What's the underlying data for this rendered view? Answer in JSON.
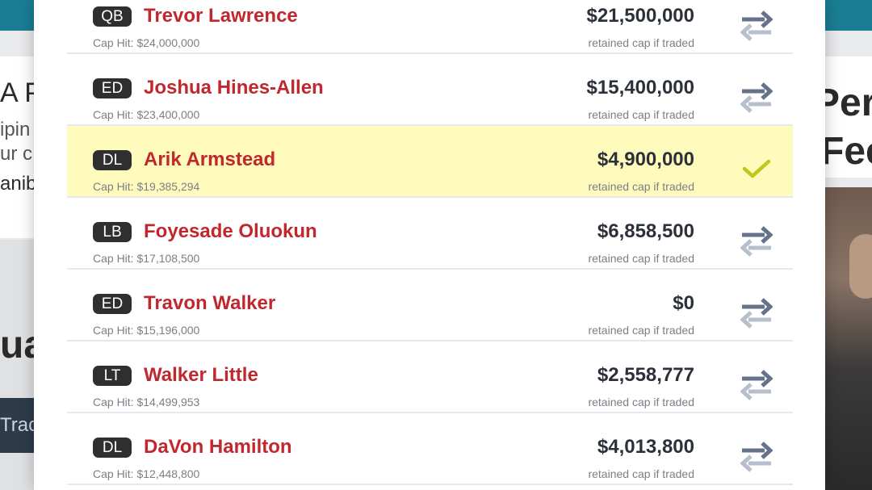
{
  "background": {
    "left_text_1": "A P",
    "left_text_2": "ipin",
    "left_text_3": "ur c",
    "left_text_4": "anib",
    "left_heading": "ua",
    "left_button": "Trac",
    "right_text_1": "Per",
    "right_text_2": "Fee"
  },
  "players": [
    {
      "position": "QB",
      "name": "Trevor Lawrence",
      "cap_hit": "Cap Hit: $24,000,000",
      "retained": "$21,500,000",
      "retained_label": "retained cap if traded",
      "icon": "trade-arrows-icon",
      "selected": false
    },
    {
      "position": "ED",
      "name": "Joshua Hines-Allen",
      "cap_hit": "Cap Hit: $23,400,000",
      "retained": "$15,400,000",
      "retained_label": "retained cap if traded",
      "icon": "trade-arrows-icon",
      "selected": false
    },
    {
      "position": "DL",
      "name": "Arik Armstead",
      "cap_hit": "Cap Hit: $19,385,294",
      "retained": "$4,900,000",
      "retained_label": "retained cap if traded",
      "icon": "checkmark-icon",
      "selected": true
    },
    {
      "position": "LB",
      "name": "Foyesade Oluokun",
      "cap_hit": "Cap Hit: $17,108,500",
      "retained": "$6,858,500",
      "retained_label": "retained cap if traded",
      "icon": "trade-arrows-icon",
      "selected": false
    },
    {
      "position": "ED",
      "name": "Travon Walker",
      "cap_hit": "Cap Hit: $15,196,000",
      "retained": "$0",
      "retained_label": "retained cap if traded",
      "icon": "trade-arrows-icon",
      "selected": false
    },
    {
      "position": "LT",
      "name": "Walker Little",
      "cap_hit": "Cap Hit: $14,499,953",
      "retained": "$2,558,777",
      "retained_label": "retained cap if traded",
      "icon": "trade-arrows-icon",
      "selected": false
    },
    {
      "position": "DL",
      "name": "DaVon Hamilton",
      "cap_hit": "Cap Hit: $12,448,800",
      "retained": "$4,013,800",
      "retained_label": "retained cap if traded",
      "icon": "trade-arrows-icon",
      "selected": false
    }
  ],
  "colors": {
    "name": "#c0282d",
    "selected_row": "#fffbbd",
    "check": "#c4c51a",
    "arrow_dark": "#66728a",
    "arrow_light": "#b7bfcc"
  }
}
